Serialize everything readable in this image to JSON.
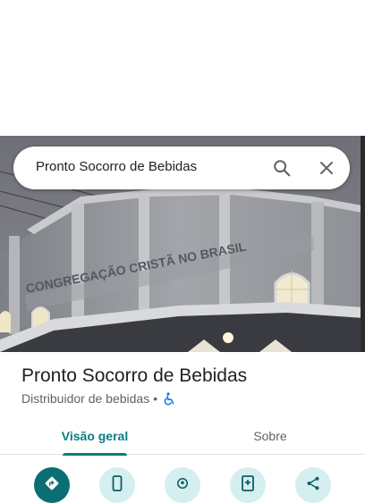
{
  "search": {
    "query": "Pronto Socorro de Bebidas"
  },
  "place": {
    "name": "Pronto Socorro de Bebidas",
    "category": "Distribuidor de bebidas",
    "separator": "•",
    "photo_sign_text": "CONGREGAÇÃO CRISTÃ NO BRASIL"
  },
  "tabs": [
    {
      "label": "Visão geral",
      "active": true
    },
    {
      "label": "Sobre",
      "active": false
    }
  ],
  "actions": [
    {
      "icon": "directions-icon"
    },
    {
      "icon": "phone-icon"
    },
    {
      "icon": "location-icon"
    },
    {
      "icon": "save-icon"
    },
    {
      "icon": "share-icon"
    }
  ],
  "colors": {
    "accent": "#0b7b80",
    "primary_action": "#0b6e73",
    "secondary_action": "#d5eef0",
    "accessibility": "#1a73e8"
  }
}
